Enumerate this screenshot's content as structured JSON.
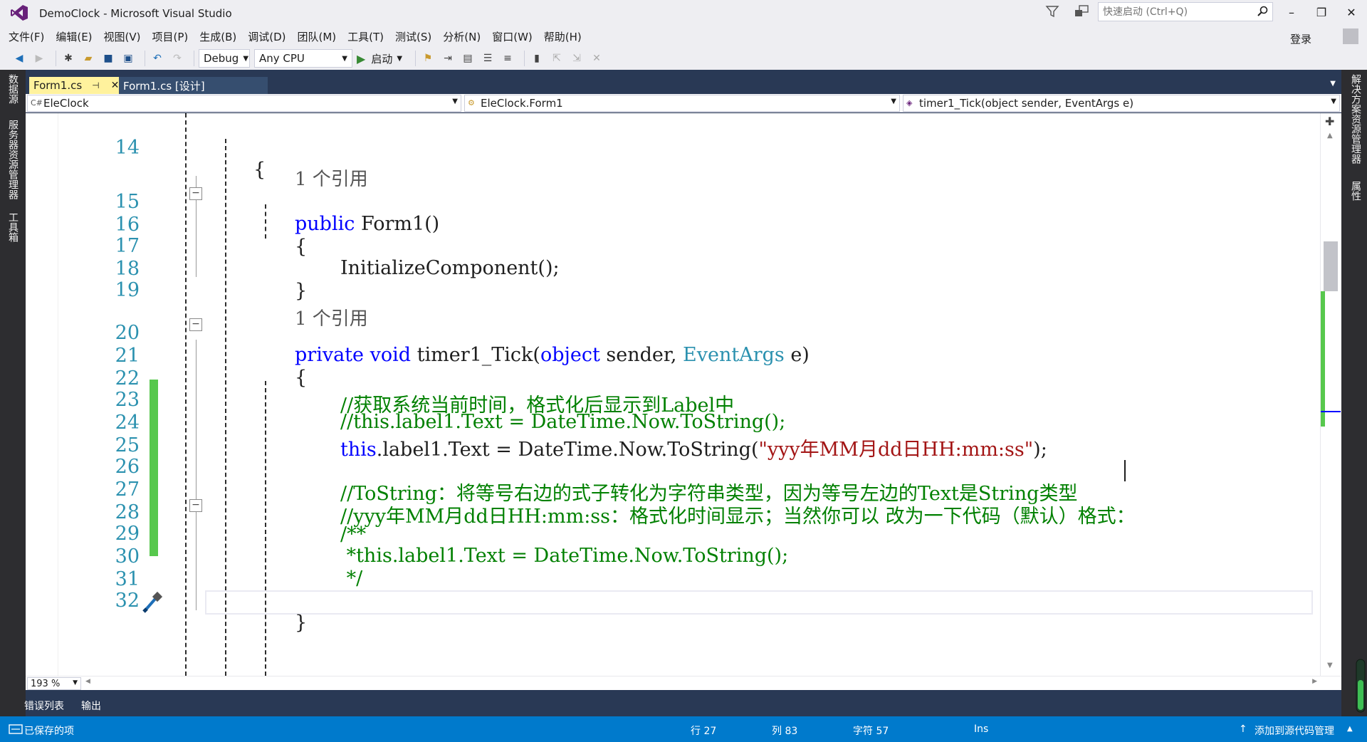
{
  "window": {
    "title": "DemoClock - Microsoft Visual Studio",
    "quick_launch_placeholder": "快速启动 (Ctrl+Q)",
    "login": "登录",
    "minimize": "–",
    "restore": "❐",
    "close": "✕"
  },
  "menu": [
    "文件(F)",
    "编辑(E)",
    "视图(V)",
    "项目(P)",
    "生成(B)",
    "调试(D)",
    "团队(M)",
    "工具(T)",
    "测试(S)",
    "分析(N)",
    "窗口(W)",
    "帮助(H)"
  ],
  "toolbar": {
    "config": "Debug",
    "platform": "Any CPU",
    "start": "启动"
  },
  "side_left_tabs": [
    "数据源",
    "服务器资源管理器",
    "工具箱"
  ],
  "side_right_tabs": [
    "解决方案资源管理器",
    "属性"
  ],
  "tabs": [
    {
      "label": "Form1.cs",
      "active": true
    },
    {
      "label": "Form1.cs [设计]",
      "active": false
    }
  ],
  "navbar": {
    "project": "EleClock",
    "type": "EleClock.Form1",
    "member": "timer1_Tick(object sender, EventArgs e)"
  },
  "code": {
    "l14": {
      "num": "14",
      "t1": "{"
    },
    "ref1": "1 个引用",
    "l15": {
      "num": "15",
      "kw": "public",
      "t2": " Form1()"
    },
    "l16": {
      "num": "16",
      "t1": "{"
    },
    "l17": {
      "num": "17",
      "t1": "InitializeComponent();"
    },
    "l18": {
      "num": "18",
      "t1": "}"
    },
    "l19": {
      "num": "19"
    },
    "ref2": "1 个引用",
    "l20": {
      "num": "20",
      "kw1": "private",
      "kw2": "void",
      "name": " timer1_Tick(",
      "obj": "object",
      "sender": " sender, ",
      "ev": "EventArgs",
      "e": " e)"
    },
    "l21": {
      "num": "21",
      "t1": "{"
    },
    "l22": {
      "num": "22",
      "cm": "//获取系统当前时间，格式化后显示到Label中"
    },
    "l23": {
      "num": "23",
      "cm": "//this.label1.Text = DateTime.Now.ToString();"
    },
    "l24": {
      "num": "24",
      "kw": "this",
      "t2": ".label1.Text = DateTime.Now.ToString(",
      "st": "\"yyy年MM月dd日HH:mm:ss\"",
      "t3": ");"
    },
    "l25": {
      "num": "25"
    },
    "l26": {
      "num": "26",
      "cm": "//ToString：将等号右边的式子转化为字符串类型，因为等号左边的Text是String类型"
    },
    "l27": {
      "num": "27",
      "cm": "//yyy年MM月dd日HH:mm:ss：格式化时间显示；当然你可以 改为一下代码（默认）格式："
    },
    "l28": {
      "num": "28",
      "cm": "/**"
    },
    "l29": {
      "num": "29",
      "cm": " *this.label1.Text = DateTime.Now.ToString();"
    },
    "l30": {
      "num": "30",
      "cm": " */"
    },
    "l31": {
      "num": "31"
    },
    "l32": {
      "num": "32",
      "t1": "}"
    }
  },
  "zoom": "193 %",
  "bottom_tabs": [
    "错误列表",
    "输出"
  ],
  "status": {
    "saved": "已保存的项",
    "line": "行 27",
    "col": "列 83",
    "char": "字符 57",
    "mode": "Ins",
    "source_control": "添加到源代码管理"
  },
  "colors": {
    "accent": "#007acc",
    "tab_active": "#fff29d",
    "doc_bg": "#293955",
    "change_bar": "#57c84d"
  }
}
